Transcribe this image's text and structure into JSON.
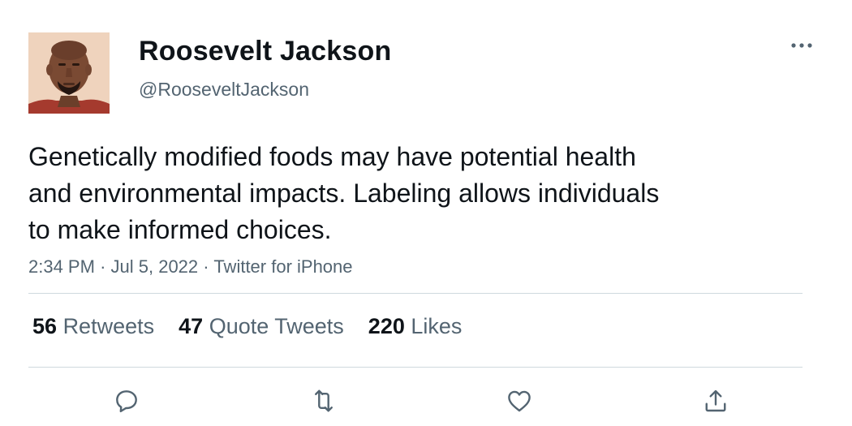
{
  "author": {
    "display_name": "Roosevelt Jackson",
    "handle": "@RooseveltJackson",
    "avatar_icon": "profile-photo"
  },
  "tweet": {
    "text_lines": [
      "Genetically modified foods may have potential health",
      "and environmental impacts. Labeling allows individuals",
      "to make informed choices."
    ],
    "time": "2:34 PM",
    "separator": "·",
    "date": "Jul 5, 2022",
    "source": "Twitter for iPhone"
  },
  "stats": {
    "retweets": {
      "count": "56",
      "label": "Retweets"
    },
    "quote_tweets": {
      "count": "47",
      "label": "Quote Tweets"
    },
    "likes": {
      "count": "220",
      "label": "Likes"
    }
  },
  "actions": {
    "reply_icon": "reply-icon",
    "retweet_icon": "retweet-icon",
    "like_icon": "heart-icon",
    "share_icon": "share-icon",
    "more_icon": "more-horizontal-icon"
  },
  "colors": {
    "text_primary": "#0f1419",
    "text_secondary": "#536471",
    "divider": "#cfd9de",
    "icon": "#536471"
  }
}
